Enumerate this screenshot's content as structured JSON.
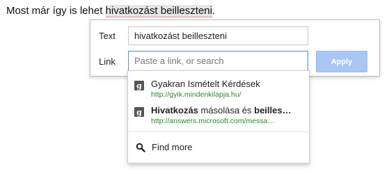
{
  "document": {
    "text_before": "Most már így is lehet ",
    "selected_text": "hivatkozást beilleszteni",
    "text_after": "."
  },
  "link_dialog": {
    "text_label": "Text",
    "text_value": "hivatkozást beilleszteni",
    "link_label": "Link",
    "link_value": "",
    "link_placeholder": "Paste a link, or search",
    "apply_label": "Apply"
  },
  "suggestions": [
    {
      "icon": "google-g-icon",
      "title_bold": "",
      "title": "Gyakran Ismételt Kérdések",
      "url": "http://gyik.mindenkilapja.hu/"
    },
    {
      "icon": "google-g-icon",
      "title_bold": "Hivatkozás",
      "title_mid": " másolása és ",
      "title_bold2": "beilles…",
      "url": "http://answers.microsoft.com/messa…"
    }
  ],
  "find_more": {
    "icon": "search-icon",
    "label": "Find more"
  },
  "colors": {
    "apply_button": "#a9c6f5",
    "url_green": "#2a8a2a",
    "focus_border": "#5b8fd6"
  }
}
